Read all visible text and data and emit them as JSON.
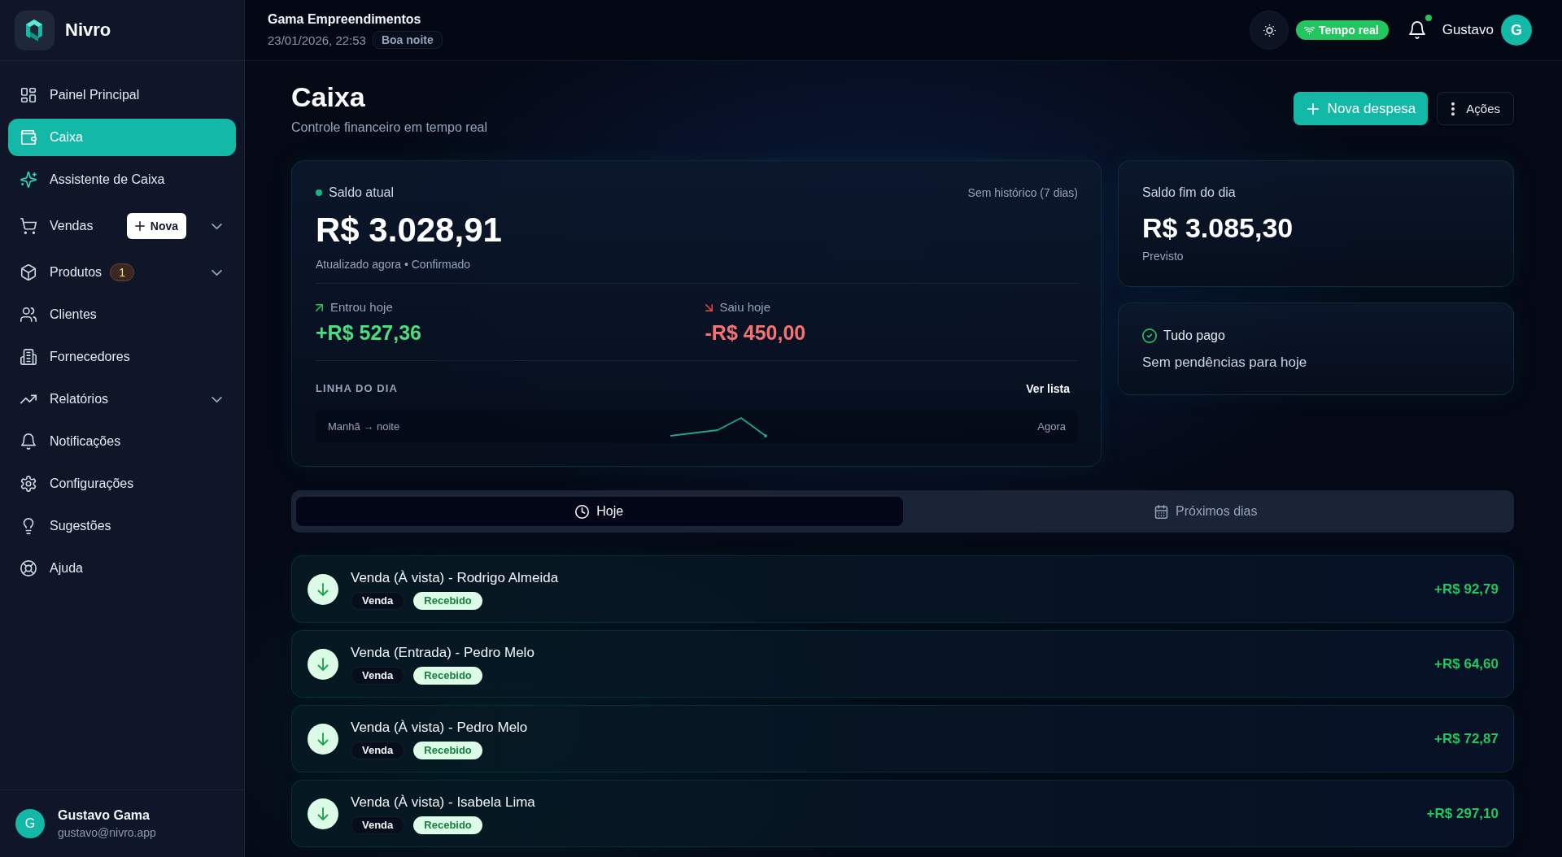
{
  "sidebar": {
    "brand": {
      "name": "Nivro"
    },
    "items": [
      {
        "label": "Painel Principal",
        "kind": "link",
        "selected": false
      },
      {
        "label": "Caixa",
        "kind": "link",
        "selected": true
      },
      {
        "label": "Assistente de Caixa",
        "kind": "link",
        "selected": false
      },
      {
        "label": "Vendas",
        "kind": "group",
        "selected": false,
        "expanded": false,
        "action": "Nova"
      },
      {
        "label": "Produtos",
        "kind": "group",
        "selected": false,
        "expanded": false,
        "badge": "1"
      },
      {
        "label": "Clientes",
        "kind": "link",
        "selected": false
      },
      {
        "label": "Fornecedores",
        "kind": "link",
        "selected": false
      },
      {
        "label": "Relatórios",
        "kind": "group",
        "selected": false,
        "expanded": false
      },
      {
        "label": "Notificações",
        "kind": "link",
        "selected": false
      },
      {
        "label": "Configurações",
        "kind": "link",
        "selected": false
      },
      {
        "label": "Sugestões",
        "kind": "link",
        "selected": false
      },
      {
        "label": "Ajuda",
        "kind": "link",
        "selected": false
      }
    ],
    "user": {
      "initial": "G",
      "name": "Gustavo Gama",
      "email": "gustavo@nivro.app"
    }
  },
  "topbar": {
    "company": "Gama Empreendimentos",
    "datetime": "23/01/2026, 22:53",
    "greeting": "Boa noite",
    "live_status": "Tempo real",
    "notifications": {
      "unread": true
    },
    "user": {
      "name": "Gustavo",
      "initial": "G"
    }
  },
  "page_header": {
    "title": "Caixa",
    "subtitle": "Controle financeiro em tempo real",
    "actions": [
      {
        "kind": "primary",
        "label": "Nova despesa"
      },
      {
        "kind": "menu",
        "label": "Ações"
      }
    ]
  },
  "balance_card": {
    "label": "Saldo atual",
    "history_note": "Sem histórico (7 dias)",
    "amount": "R$ 3.028,91",
    "meta": "Atualizado agora • Confirmado",
    "flows": [
      {
        "kind": "in",
        "label": "Entrou hoje",
        "amount": "+R$ 527,36"
      },
      {
        "kind": "out",
        "label": "Saiu hoje",
        "amount": "-R$ 450,00"
      }
    ],
    "timeline": {
      "title": "LINHA DO DIA",
      "link": "Ver lista",
      "start_label": "Manhã → noite",
      "end_label": "Agora"
    }
  },
  "forecast_card": {
    "label": "Saldo fim do dia",
    "amount": "R$ 3.085,30",
    "note": "Previsto"
  },
  "pending_card": {
    "title": "Tudo pago",
    "text": "Sem pendências para hoje"
  },
  "tabs": [
    {
      "label": "Hoje",
      "selected": true
    },
    {
      "label": "Próximos dias",
      "selected": false
    }
  ],
  "transactions": [
    {
      "title": "Venda (À vista) - Rodrigo Almeida",
      "category": "Venda",
      "status": "Recebido",
      "amount": "+R$ 92,79"
    },
    {
      "title": "Venda (Entrada) - Pedro Melo",
      "category": "Venda",
      "status": "Recebido",
      "amount": "+R$ 64,60"
    },
    {
      "title": "Venda (À vista) - Pedro Melo",
      "category": "Venda",
      "status": "Recebido",
      "amount": "+R$ 72,87"
    },
    {
      "title": "Venda (À vista) - Isabela Lima",
      "category": "Venda",
      "status": "Recebido",
      "amount": "+R$ 297,10"
    }
  ]
}
